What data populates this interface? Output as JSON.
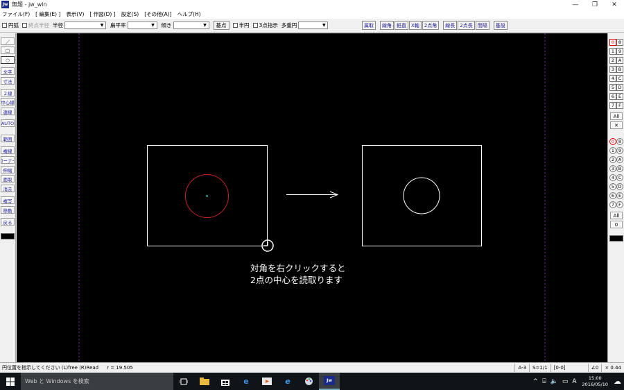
{
  "window": {
    "icon_label": "Jw",
    "title": "無題 - jw_win",
    "controls": [
      "—",
      "❐",
      "✕"
    ]
  },
  "menu": [
    "ファイル(F)",
    "[ 編集(E) ]",
    "表示(V)",
    "[ 作図(D) ]",
    "設定(S)",
    "[その他(A)]",
    "ヘルプ(H)"
  ],
  "toolbar": {
    "arc_label": "円弧",
    "radius_label": "半径",
    "flatness_label": "扁平率",
    "tilt_label": "傾き",
    "base_point_label": "基点",
    "half_circle_label": "半円",
    "three_point_label": "3点指示",
    "multi_circle_label": "多重円",
    "disabled_label": "終点半径",
    "right_buttons": [
      "属取",
      "線角",
      "鉛直",
      "X軸",
      "2点角",
      "線長",
      "2点長",
      "間隔",
      "基設"
    ]
  },
  "left_tools": [
    "／",
    "□",
    "○",
    "文字",
    "寸法",
    "２線",
    "中心線",
    "連線",
    "AUTO",
    "範囲",
    "複線",
    "コーナー",
    "伸縮",
    "面取",
    "消去",
    "複写",
    "移動",
    "戻る"
  ],
  "layers": {
    "top_rows": [
      [
        "0",
        "8"
      ],
      [
        "1",
        "9"
      ],
      [
        "2",
        "A"
      ],
      [
        "3",
        "B"
      ],
      [
        "4",
        "C"
      ],
      [
        "5",
        "D"
      ],
      [
        "6",
        "E"
      ],
      [
        "7",
        "F"
      ]
    ],
    "all_label": "All",
    "x_label": "✕",
    "group_rows": [
      [
        "0",
        "8"
      ],
      [
        "1",
        "9"
      ],
      [
        "2",
        "A"
      ],
      [
        "3",
        "B"
      ],
      [
        "4",
        "C"
      ],
      [
        "5",
        "D"
      ],
      [
        "6",
        "E"
      ],
      [
        "7",
        "F"
      ]
    ],
    "group_all_label": "All",
    "group_zero_label": "0"
  },
  "canvas": {
    "caption_line1": "対角を右クリックすると",
    "caption_line2": "2点の中心を読取ります",
    "colors": {
      "background": "#000000",
      "shape": "#ffffff",
      "circle_active": "#cc2222",
      "guide": "#7a2a9a"
    }
  },
  "status": {
    "message": "円位置を指示してください (L)free (R)Read",
    "radius": "r = 19.505",
    "cells": [
      "A-3",
      "S=1/1",
      "[0-0]",
      "∠0",
      "× 0.44"
    ]
  },
  "taskbar": {
    "search_placeholder": "Web と Windows を検索",
    "tray_lang": "A",
    "time": "15:00",
    "date": "2016/05/10"
  }
}
